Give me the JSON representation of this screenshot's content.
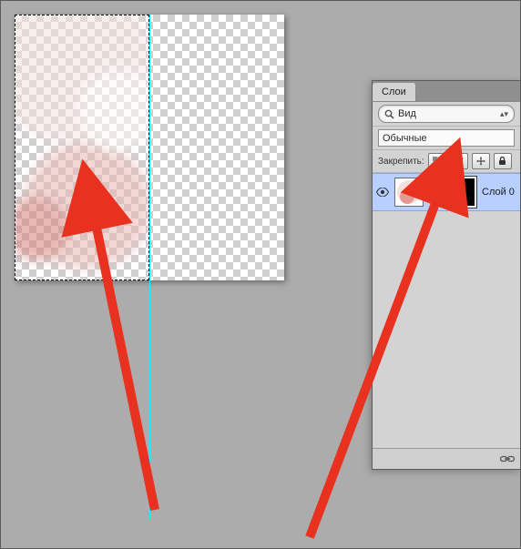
{
  "panel": {
    "tab_label": "Слои",
    "filter_label": "Вид",
    "blend_mode": "Обычные",
    "lock_label": "Закрепить:"
  },
  "layer": {
    "name": "Слой 0"
  },
  "icons": {
    "search": "search-icon",
    "eye": "eye-icon",
    "link_small": "link-icon",
    "lock_pixels": "lock-pixels-icon",
    "lock_brush": "lock-brush-icon",
    "lock_move": "lock-move-icon",
    "lock_all": "lock-all-icon",
    "footer_link": "link-chain-icon"
  },
  "colors": {
    "selection": "#b8cfff",
    "guide": "#18f0ff",
    "arrow": "#e8321f"
  }
}
